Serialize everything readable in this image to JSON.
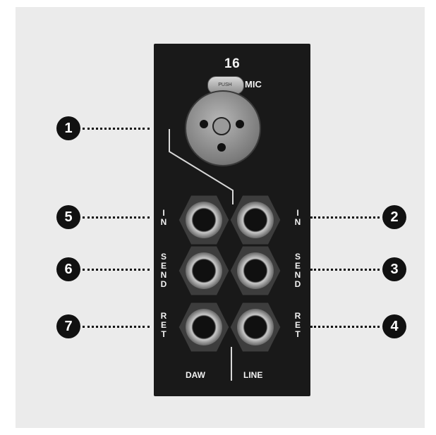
{
  "panel": {
    "channel_number": "16",
    "mic_label": "MIC",
    "latch_text": "PUSH",
    "jack_labels": {
      "in": "I N",
      "send": "S E N D",
      "ret": "R E T"
    },
    "bottom_labels": {
      "left": "DAW",
      "right": "LINE"
    }
  },
  "callouts": {
    "c1": "1",
    "c2": "2",
    "c3": "3",
    "c4": "4",
    "c5": "5",
    "c6": "6",
    "c7": "7"
  },
  "colors": {
    "panel": "#191919",
    "background": "#ebebeb",
    "callout": "#111111",
    "text": "#f2f2f2"
  }
}
